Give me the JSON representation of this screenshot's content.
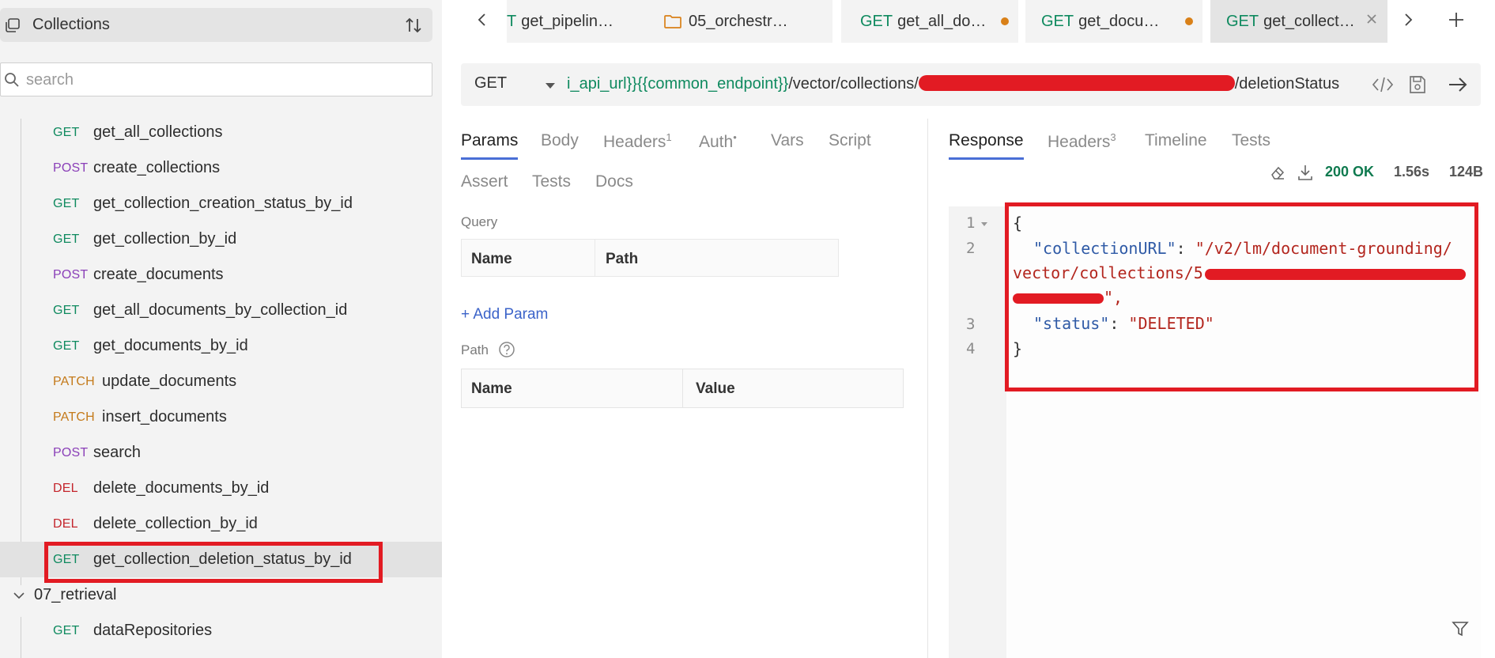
{
  "sidebar": {
    "title": "Collections",
    "search_placeholder": "search",
    "requests": [
      {
        "method": "GET",
        "name": "get_all_collections"
      },
      {
        "method": "POST",
        "name": "create_collections"
      },
      {
        "method": "GET",
        "name": "get_collection_creation_status_by_id"
      },
      {
        "method": "GET",
        "name": "get_collection_by_id"
      },
      {
        "method": "POST",
        "name": "create_documents"
      },
      {
        "method": "GET",
        "name": "get_all_documents_by_collection_id"
      },
      {
        "method": "GET",
        "name": "get_documents_by_id"
      },
      {
        "method": "PATCH",
        "name": "update_documents"
      },
      {
        "method": "PATCH",
        "name": "insert_documents"
      },
      {
        "method": "POST",
        "name": "search"
      },
      {
        "method": "DEL",
        "name": "delete_documents_by_id"
      },
      {
        "method": "DEL",
        "name": "delete_collection_by_id"
      },
      {
        "method": "GET",
        "name": "get_collection_deletion_status_by_id"
      }
    ],
    "folder": "07_retrieval",
    "folder_child": {
      "method": "GET",
      "name": "dataRepositories"
    }
  },
  "tabs": [
    {
      "method": "T",
      "label": "get_pipelin…"
    },
    {
      "method": "",
      "label": "05_orchestr…"
    },
    {
      "method": "GET",
      "label": "get_all_do…"
    },
    {
      "method": "GET",
      "label": "get_docu…"
    },
    {
      "method": "GET",
      "label": "get_collect…"
    }
  ],
  "url_bar": {
    "method": "GET",
    "url_var_part": "i_api_url}}{{common_endpoint}}",
    "url_path_prefix": "/vector/collections/",
    "url_path_suffix": "/deletionStatus"
  },
  "request_tabs": {
    "params": "Params",
    "body": "Body",
    "headers": "Headers",
    "headers_count": "1",
    "auth": "Auth",
    "auth_marker": "•",
    "vars": "Vars",
    "script": "Script",
    "assert": "Assert",
    "tests": "Tests",
    "docs": "Docs"
  },
  "query": {
    "label": "Query",
    "col_name": "Name",
    "col_path": "Path",
    "add_param": "+ Add Param"
  },
  "path": {
    "label": "Path",
    "col_name": "Name",
    "col_value": "Value"
  },
  "response_tabs": {
    "response": "Response",
    "headers": "Headers",
    "headers_count": "3",
    "timeline": "Timeline",
    "tests": "Tests"
  },
  "response_status": {
    "status": "200 OK",
    "time": "1.56s",
    "size": "124B"
  },
  "response_body": {
    "line_numbers": [
      "1",
      "2",
      "3",
      "4"
    ],
    "open_brace": "{",
    "close_brace": "}",
    "key_url": "\"collectionURL\"",
    "url_value_line1": "\"/v2/lm/document-grounding/",
    "url_value_line2": "vector/collections/5",
    "url_value_end": "\",",
    "key_status": "\"status\"",
    "status_value": "\"DELETED\"",
    "colon": ": "
  },
  "colors": {
    "get": "#0f8a5f",
    "post": "#8a3fb8",
    "patch": "#c47a1a",
    "del": "#c4252c",
    "annotation_red": "#e21b23",
    "accent_blue": "#4a6fd6"
  }
}
